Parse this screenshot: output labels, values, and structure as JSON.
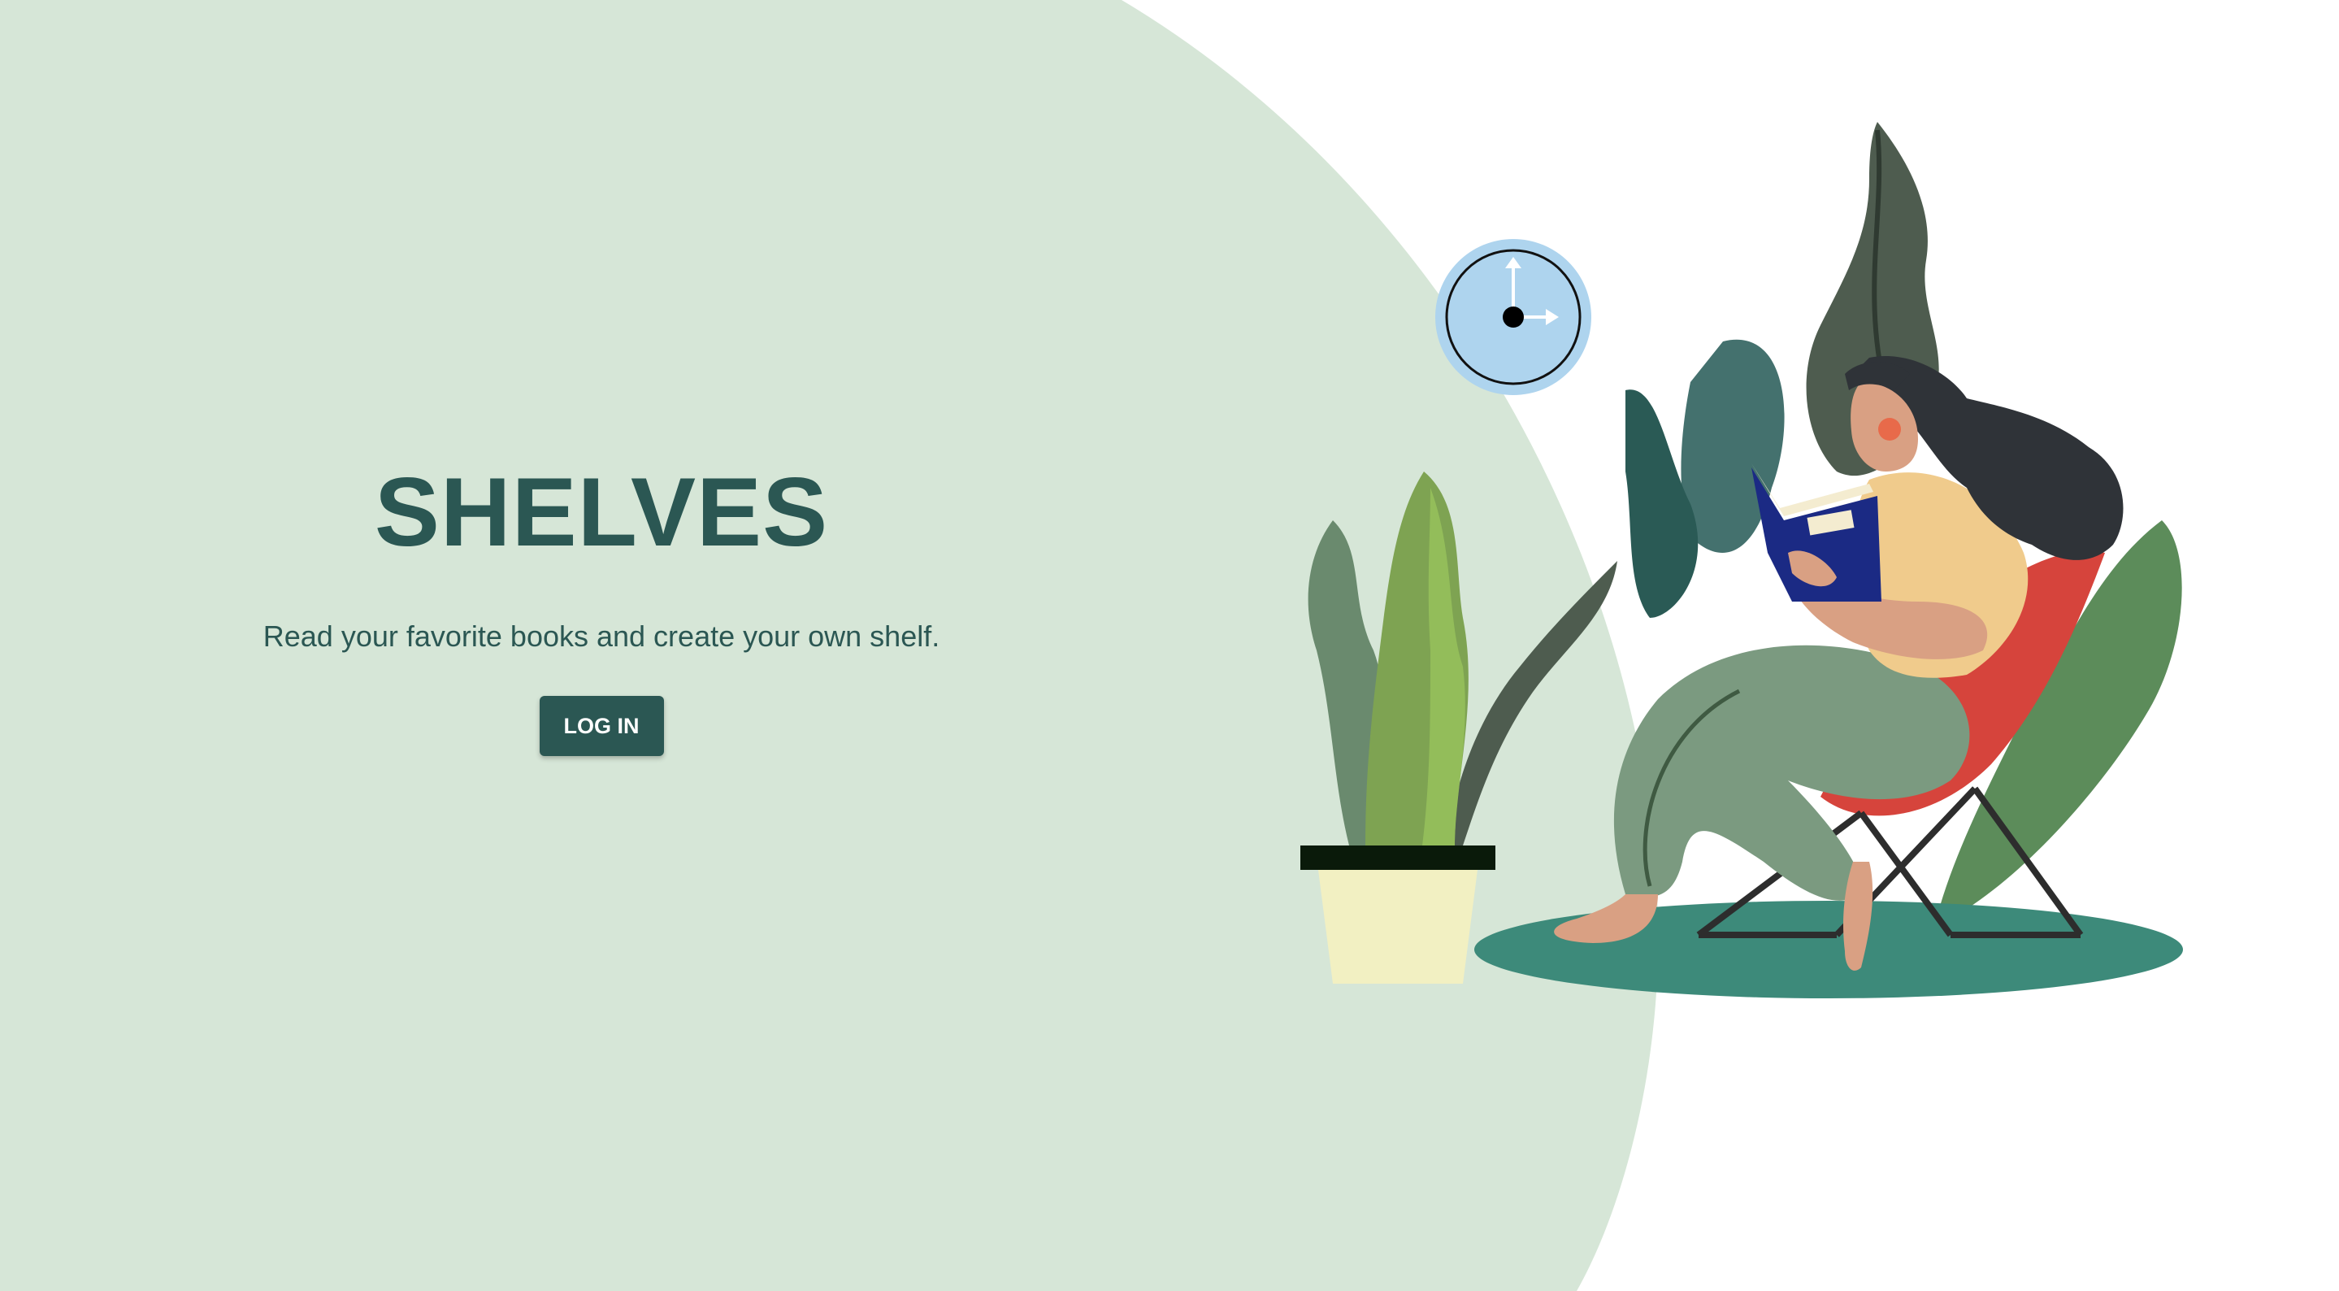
{
  "hero": {
    "title": "SHELVES",
    "subtitle": "Read your favorite books and create your own shelf.",
    "login_label": "LOG IN"
  },
  "colors": {
    "background_light_green": "#d6e6d7",
    "brand_dark_teal": "#2b5753",
    "white": "#ffffff"
  },
  "illustration": {
    "icons": [
      "wall-clock-icon",
      "potted-plant-icon",
      "reading-woman-icon",
      "chair-icon",
      "book-icon",
      "rug-icon"
    ]
  }
}
